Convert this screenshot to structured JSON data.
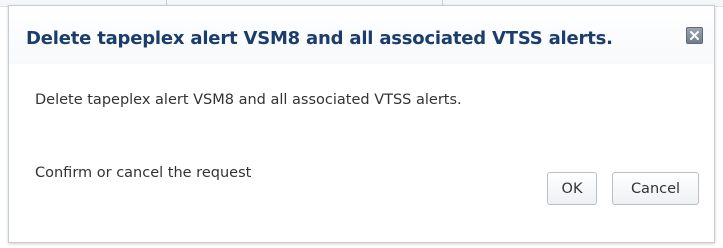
{
  "dialog": {
    "title": "Delete tapeplex alert VSM8 and all associated VTSS alerts.",
    "close_icon": "close-icon",
    "message_primary": "Delete tapeplex alert VSM8 and all associated VTSS alerts.",
    "message_secondary": "Confirm or cancel the request",
    "buttons": {
      "ok_label": "OK",
      "cancel_label": "Cancel"
    }
  },
  "colors": {
    "title_text": "#1b3d6b",
    "body_text": "#333333",
    "border": "#c4ccd4"
  }
}
